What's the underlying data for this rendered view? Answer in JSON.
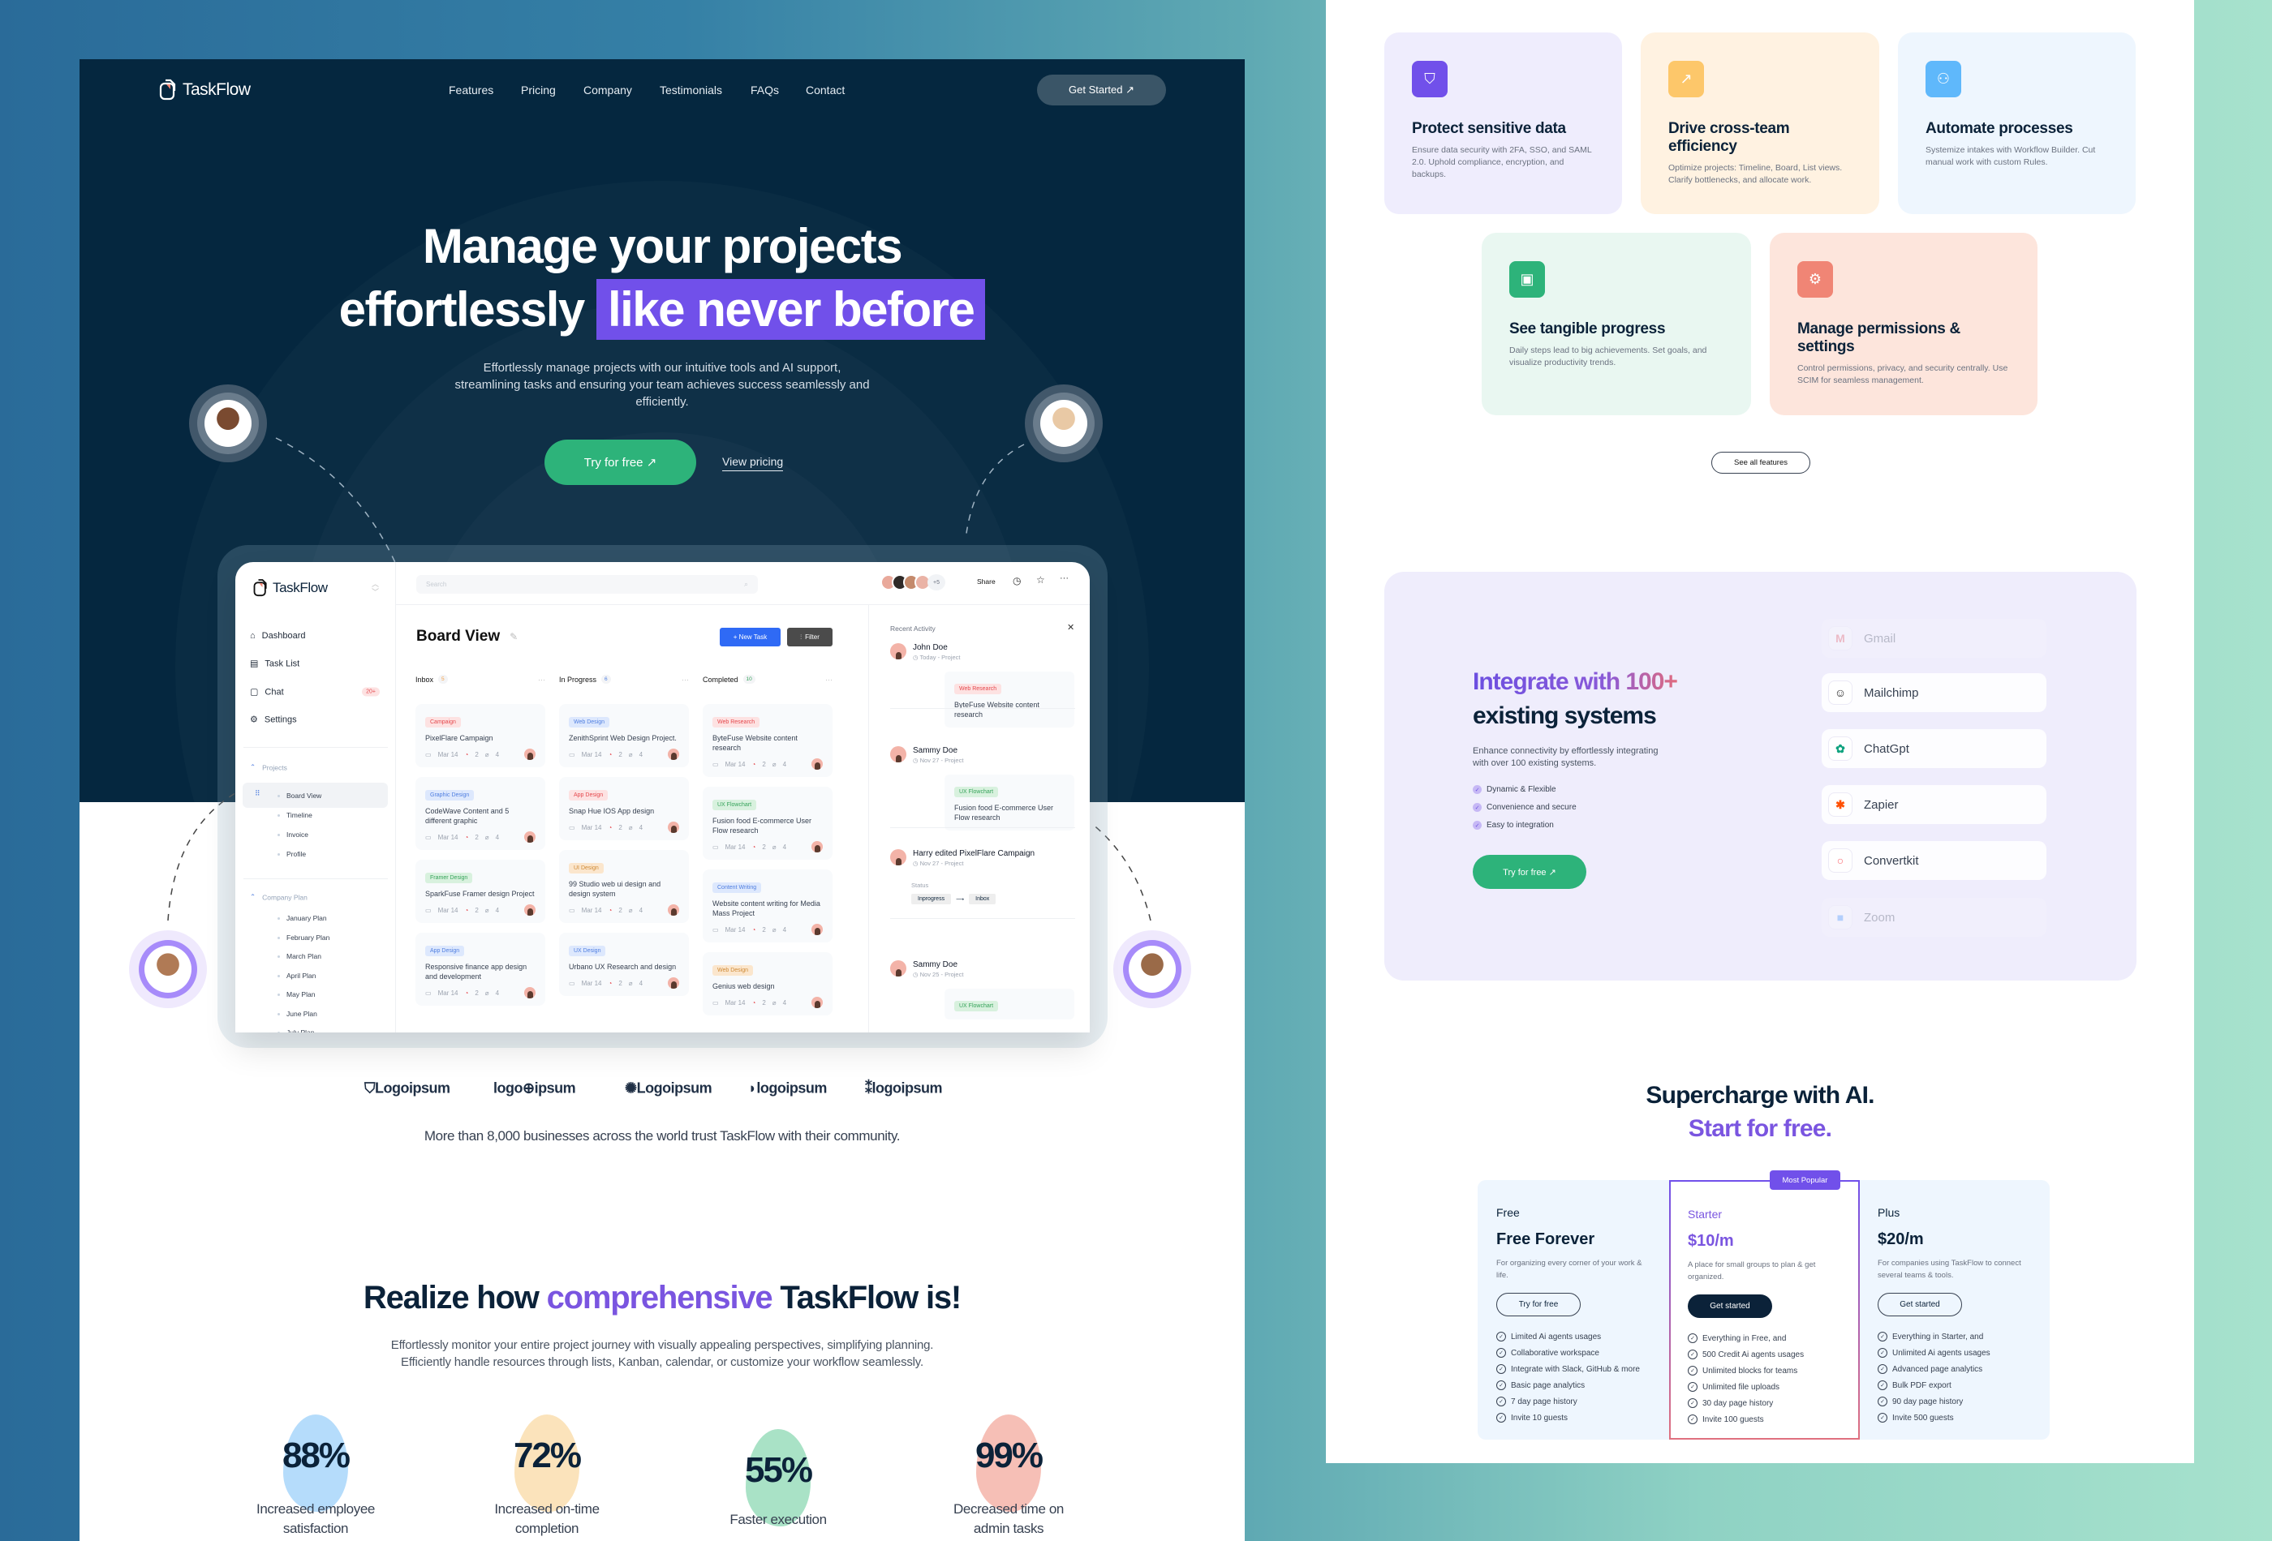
{
  "colors": {
    "navy": "#05273f",
    "accent_purple": "#7150ea",
    "accent_green": "#2db37a",
    "dark_button": "#0b2239"
  },
  "nav": {
    "brand": "TaskFlow",
    "links": [
      "Features",
      "Pricing",
      "Company",
      "Testimonials",
      "FAQs",
      "Contact"
    ],
    "cta": "Get Started ↗"
  },
  "hero": {
    "line1": "Manage your projects",
    "line2_plain": "effortlessly",
    "line2_highlight": "like never before",
    "subtitle": [
      "Effortlessly manage projects with our intuitive tools and AI support,",
      "streamlining tasks and ensuring your team achieves success seamlessly and",
      "efficiently."
    ],
    "primary_cta": "Try for free ↗",
    "secondary_cta": "View pricing"
  },
  "app": {
    "brand": "TaskFlow",
    "search_placeholder": "Search",
    "sidebar": {
      "items": [
        {
          "label": "Dashboard",
          "icon": "home-icon"
        },
        {
          "label": "Task List",
          "icon": "file-icon"
        },
        {
          "label": "Chat",
          "icon": "chat-icon",
          "badge": "20+"
        },
        {
          "label": "Settings",
          "icon": "gear-icon"
        }
      ],
      "projects_label": "Projects",
      "projects": [
        "Board View",
        "Timeline",
        "Invoice",
        "Profile"
      ],
      "plan_label": "Company Plan",
      "plans": [
        "January Plan",
        "February Plan",
        "March Plan",
        "April Plan",
        "May Plan",
        "June Plan",
        "July Plan"
      ]
    },
    "topbar": {
      "more_members": "+5",
      "share": "Share"
    },
    "title": "Board View",
    "new_task": "+ New Task",
    "filter": "Filter",
    "columns": [
      {
        "name": "Inbox",
        "count": "5",
        "count_color": "#f59e42",
        "cards": [
          {
            "tag": "Campaign",
            "tone": "tred",
            "title": "PixelFlare Campaign"
          },
          {
            "tag": "Graphic Design",
            "tone": "tblue",
            "title": "CodeWave Content and 5 different graphic"
          },
          {
            "tag": "Framer Design",
            "tone": "tgreen",
            "title": "SparkFuse Framer design Project"
          },
          {
            "tag": "App Design",
            "tone": "tblue",
            "title": "Responsive finance app design and development"
          }
        ]
      },
      {
        "name": "In Progress",
        "count": "6",
        "count_color": "#4f7ee0",
        "cards": [
          {
            "tag": "Web Design",
            "tone": "tblue",
            "title": "ZenithSprint Web Design Project."
          },
          {
            "tag": "App Design",
            "tone": "tred",
            "title": "Snap Hue IOS App design"
          },
          {
            "tag": "UI Design",
            "tone": "torange",
            "title": "99 Studio web ui design and design system"
          },
          {
            "tag": "UX Design",
            "tone": "tblue",
            "title": "Urbano UX Research and design"
          }
        ]
      },
      {
        "name": "Completed",
        "count": "10",
        "count_color": "#36a35a",
        "cards": [
          {
            "tag": "Web Research",
            "tone": "tred",
            "title": "ByteFuse Website content research"
          },
          {
            "tag": "UX Flowchart",
            "tone": "tgreen",
            "title": "Fusion food E-commerce User Flow research"
          },
          {
            "tag": "Content Writing",
            "tone": "tblue",
            "title": "Website content writing for Media Mass Project"
          },
          {
            "tag": "Web Design",
            "tone": "torange",
            "title": "Genius web design"
          }
        ]
      }
    ],
    "card_meta": {
      "date": "Mar 14",
      "comments": "2",
      "attachments": "4"
    },
    "activity": {
      "title": "Recent Activity",
      "entries": [
        {
          "name": "John Doe",
          "sub": "Today - Project",
          "tag": "Web Research",
          "tone": "tred",
          "text": "ByteFuse Website content research"
        },
        {
          "name": "Sammy Doe",
          "sub": "Nov 27 - Project",
          "tag": "UX Flowchart",
          "tone": "tgreen",
          "text": "Fusion food E-commerce User Flow research"
        },
        {
          "name": "Harry edited PixelFlare Campaign",
          "sub": "Nov 27 - Project",
          "status_label": "Status",
          "from": "Inprogress",
          "to": "Inbox"
        },
        {
          "name": "Sammy Doe",
          "sub": "Nov 25 - Project",
          "tag": "UX Flowchart",
          "tone": "tgreen"
        }
      ]
    }
  },
  "logos": [
    "Logoipsum",
    "logo⊕ipsum",
    "Logoipsum",
    "logoipsum",
    "logoipsum"
  ],
  "trust_text": "More than 8,000 businesses across the world trust TaskFlow with their community.",
  "realize": {
    "pre": "Realize how ",
    "accent": "comprehensive",
    "post": " TaskFlow is!",
    "desc": [
      "Effortlessly monitor your entire project journey with visually appealing perspectives, simplifying planning.",
      "Efficiently handle resources through lists, Kanban, calendar, or customize your workflow seamlessly."
    ]
  },
  "stats": [
    {
      "value": "88%",
      "label": "Increased employee satisfaction",
      "color": "#b5dcfb"
    },
    {
      "value": "72%",
      "label": "Increased on-time completion",
      "color": "#fbe3bb"
    },
    {
      "value": "55%",
      "label": "Faster execution",
      "color": "#a9e2c6"
    },
    {
      "value": "99%",
      "label": "Decreased time on admin tasks",
      "color": "#f6bfb6"
    }
  ],
  "features": [
    {
      "title": "Protect sensitive data",
      "desc": "Ensure data security with 2FA, SSO, and SAML 2.0. Uphold compliance, encryption, and backups.",
      "icon": "shield-check-icon",
      "bg": "#efedfd",
      "icon_bg": "#7150ea"
    },
    {
      "title": "Drive cross-team efficiency",
      "desc": "Optimize projects: Timeline, Board, List views. Clarify bottlenecks, and allocate work.",
      "icon": "chart-icon",
      "bg": "#fff2e1",
      "icon_bg": "#fdc76a"
    },
    {
      "title": "Automate processes",
      "desc": "Systemize intakes with Workflow Builder. Cut manual work with custom Rules.",
      "icon": "workflow-icon",
      "bg": "#eef6fe",
      "icon_bg": "#5fb8fb"
    },
    {
      "title": "See tangible progress",
      "desc": "Daily steps lead to big achievements. Set goals, and visualize productivity trends.",
      "icon": "progress-icon",
      "bg": "#e9f7f1",
      "icon_bg": "#2db37a"
    },
    {
      "title": "Manage permissions & settings",
      "desc": "Control permissions, privacy, and security centrally. Use SCIM for seamless management.",
      "icon": "gear-icon",
      "bg": "#fde5dc",
      "icon_bg": "#f08575"
    }
  ],
  "see_all": "See all features",
  "integrations": {
    "title_accent": "Integrate with 100+",
    "title_rest": "existing systems",
    "desc": [
      "Enhance connectivity by effortlessly integrating",
      "with over 100 existing systems."
    ],
    "bullets": [
      "Dynamic & Flexible",
      "Convenience and secure",
      "Easy to integration"
    ],
    "cta": "Try for free ↗",
    "apps": [
      {
        "name": "Gmail",
        "glyph": "M",
        "color": "#e5484d",
        "faded": true
      },
      {
        "name": "Mailchimp",
        "glyph": "☺",
        "color": "#222",
        "faded": false
      },
      {
        "name": "ChatGpt",
        "glyph": "✿",
        "color": "#10a37f",
        "faded": false
      },
      {
        "name": "Zapier",
        "glyph": "✱",
        "color": "#ff4f00",
        "faded": false
      },
      {
        "name": "Convertkit",
        "glyph": "○",
        "color": "#fb6970",
        "faded": false
      },
      {
        "name": "Zoom",
        "glyph": "■",
        "color": "#2d8cff",
        "faded": true
      }
    ]
  },
  "supercharge": {
    "line1": "Supercharge with AI.",
    "line2": "Start for free."
  },
  "pricing": [
    {
      "label": "Free",
      "price": "Free Forever",
      "desc": "For organizing every corner of your work & life.",
      "button": "Try for free",
      "features": [
        "Limited Ai agents usages",
        "Collaborative workspace",
        "Integrate with Slack, GitHub & more",
        "Basic page analytics",
        "7 day page history",
        "Invite 10 guests"
      ]
    },
    {
      "label": "Starter",
      "price": "$10/m",
      "desc": "A place for small groups to plan & get organized.",
      "button": "Get started",
      "badge": "Most Popular",
      "features": [
        "Everything in Free, and",
        "500 Credit Ai agents usages",
        "Unlimited blocks for teams",
        "Unlimited file uploads",
        "30 day page history",
        "Invite 100 guests"
      ]
    },
    {
      "label": "Plus",
      "price": "$20/m",
      "desc": "For companies using TaskFlow to connect several teams & tools.",
      "button": "Get started",
      "features": [
        "Everything in Starter, and",
        "Unlimited  Ai agents usages",
        "Advanced page analytics",
        "Bulk PDF export",
        "90 day page history",
        "Invite 500 guests"
      ]
    }
  ]
}
